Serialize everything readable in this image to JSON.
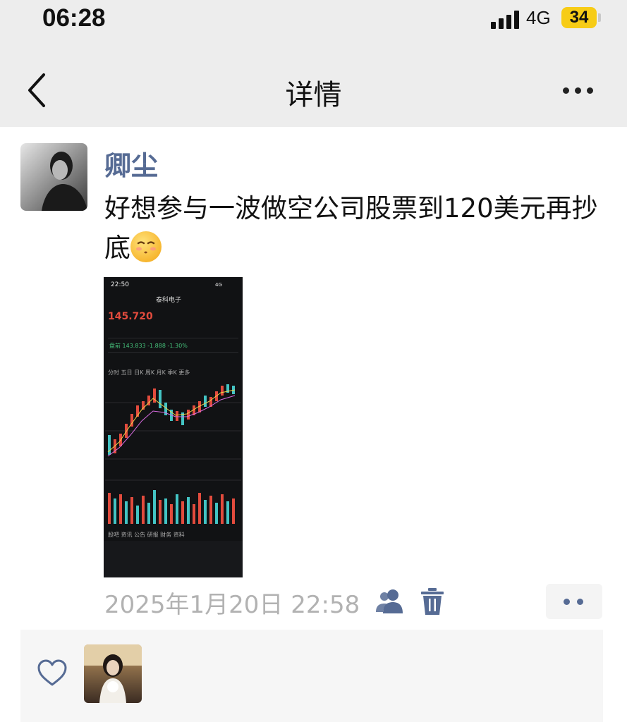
{
  "status_bar": {
    "time": "06:28",
    "network": "4G",
    "battery": "34"
  },
  "nav": {
    "title": "详情"
  },
  "post": {
    "author": "卿尘",
    "text": "好想参与一波做空公司股票到120美元再抄底",
    "emoji": "smirking-kiss-emoji",
    "timestamp": "2025年1月20日 22:58"
  },
  "screenshot": {
    "time": "22:50",
    "network": "4G",
    "stock_name": "泰科电子",
    "price": "145.720",
    "premarket": "盘前 143.833 -1.888 -1.30%",
    "tabs": "分时  五日  日K  周K  月K  季K  更多",
    "bottom_tabs": "股吧  资讯  公告  研报  财务  资料"
  },
  "colors": {
    "link_blue": "#566b94",
    "nav_bg": "#ededed",
    "up_red": "#e24b3d",
    "down_teal": "#43c4c4",
    "battery_yellow": "#f7cc16"
  }
}
